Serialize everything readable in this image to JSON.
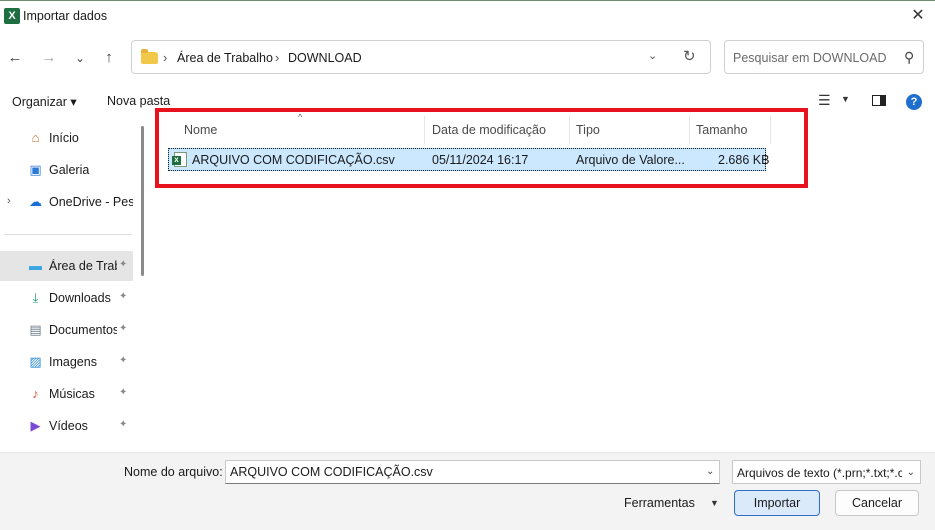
{
  "window": {
    "title": "Importar dados",
    "app_icon_letter": "X",
    "close_glyph": "✕"
  },
  "nav": {
    "back_glyph": "←",
    "forward_glyph": "→",
    "recent_glyph": "⌄",
    "up_glyph": "↑"
  },
  "address": {
    "separator": "›",
    "crumbs": [
      "Área de Trabalho",
      "DOWNLOAD"
    ],
    "dropdown_glyph": "⌄",
    "refresh_glyph": "↻"
  },
  "search": {
    "placeholder": "Pesquisar em DOWNLOAD",
    "icon": "search-icon",
    "icon_glyph": "⚲"
  },
  "commandbar": {
    "organize_label": "Organizar ▾",
    "new_folder_label": "Nova pasta",
    "view_glyph": "☰",
    "view_dropdown_glyph": "▼",
    "help_glyph": "?"
  },
  "sidebar": {
    "items": [
      {
        "label": "Início",
        "icon": "home-icon",
        "glyph": "⌂",
        "color": "#c96a2b",
        "pinned": false,
        "expandable": false,
        "selected": false
      },
      {
        "label": "Galeria",
        "icon": "gallery-icon",
        "glyph": "▣",
        "color": "#2b7bd6",
        "pinned": false,
        "expandable": false,
        "selected": false
      },
      {
        "label": "OneDrive - Pessoal",
        "icon": "onedrive-icon",
        "glyph": "☁",
        "color": "#1670d6",
        "pinned": false,
        "expandable": true,
        "selected": false
      },
      {
        "label": "Área de Trabalho",
        "icon": "desktop-icon",
        "glyph": "▬",
        "color": "#3aa5e0",
        "pinned": true,
        "expandable": false,
        "selected": true
      },
      {
        "label": "Downloads",
        "icon": "downloads-icon",
        "glyph": "⤓",
        "color": "#1f9b6e",
        "pinned": true,
        "expandable": false,
        "selected": false
      },
      {
        "label": "Documentos",
        "icon": "documents-icon",
        "glyph": "▤",
        "color": "#6a7a8a",
        "pinned": true,
        "expandable": false,
        "selected": false
      },
      {
        "label": "Imagens",
        "icon": "pictures-icon",
        "glyph": "▨",
        "color": "#2b8ad6",
        "pinned": true,
        "expandable": false,
        "selected": false
      },
      {
        "label": "Músicas",
        "icon": "music-icon",
        "glyph": "♪",
        "color": "#d9553b",
        "pinned": true,
        "expandable": false,
        "selected": false
      },
      {
        "label": "Vídeos",
        "icon": "videos-icon",
        "glyph": "▶",
        "color": "#7a4bd6",
        "pinned": true,
        "expandable": false,
        "selected": false
      }
    ],
    "pin_glyph": "📌",
    "chevron_glyph": "›"
  },
  "filelist": {
    "sort_glyph": "^",
    "columns": [
      "Nome",
      "Data de modificação",
      "Tipo",
      "Tamanho"
    ],
    "rows": [
      {
        "name": "ARQUIVO COM CODIFICAÇÃO.csv",
        "modified": "05/11/2024 16:17",
        "type": "Arquivo de Valore...",
        "size": "2.686 KB",
        "icon": "csv-file-icon",
        "selected": true
      }
    ]
  },
  "footer": {
    "filename_label": "Nome do arquivo:",
    "filename_value": "ARQUIVO COM CODIFICAÇÃO.csv",
    "filter_value": "Arquivos de texto (*.prn;*.txt;*.csv)",
    "dropdown_glyph": "⌄",
    "tools_label": "Ferramentas",
    "tools_glyph": "▼",
    "import_label": "Importar",
    "cancel_label": "Cancelar"
  },
  "colors": {
    "accent": "#2d6fc7",
    "selection": "#cce8ff",
    "highlight_annotation": "#e8121f"
  }
}
